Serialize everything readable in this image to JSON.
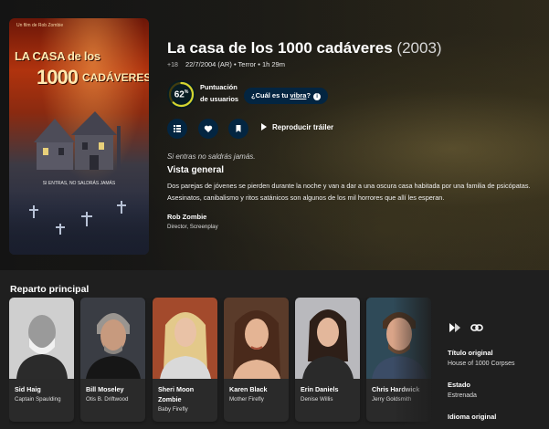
{
  "poster": {
    "credit": "Un film de Rob Zombie",
    "title_line1": "LA CASA de los",
    "title_line2": "1000",
    "title_line3": "CADÁVERES",
    "tagline": "SI ENTRAS, NO SALDRÁS JAMÁS"
  },
  "movie": {
    "title": "La casa de los 1000 cadáveres",
    "year": "(2003)",
    "certification": "+18",
    "release": "22/7/2004 (AR)",
    "genre": "Terror",
    "runtime": "1h 29m",
    "separator": "•"
  },
  "score": {
    "value": "62",
    "unit": "%",
    "fraction": 0.62,
    "label": "Puntuación de usuarios",
    "ring_color": "#d2d531"
  },
  "vibe": {
    "prefix": "¿Cuál es tu ",
    "link": "vibra",
    "suffix": "?",
    "info": "i"
  },
  "actions": {
    "trailer_label": "Reproducir tráiler",
    "list_icon": "list-icon",
    "favorite_icon": "heart-icon",
    "watchlist_icon": "bookmark-icon"
  },
  "tagline": "Si entras no saldrás jamás.",
  "overview": {
    "heading": "Vista general",
    "text": "Dos parejas de jóvenes se pierden durante la noche y van a dar a una oscura casa habitada por una familia de psicópatas. Asesinatos, canibalismo y ritos satánicos son algunos de los mil horrores que allí les esperan."
  },
  "crew": [
    {
      "name": "Rob Zombie",
      "job": "Director, Screenplay"
    }
  ],
  "cast_section": {
    "heading": "Reparto principal",
    "members": [
      {
        "name": "Sid Haig",
        "character": "Captain Spaulding"
      },
      {
        "name": "Bill Moseley",
        "character": "Otis B. Driftwood"
      },
      {
        "name": "Sheri Moon Zombie",
        "character": "Baby Firefly"
      },
      {
        "name": "Karen Black",
        "character": "Mother Firefly"
      },
      {
        "name": "Erin Daniels",
        "character": "Denise Willis"
      },
      {
        "name": "Chris Hardwick",
        "character": "Jerry Goldsmith"
      }
    ]
  },
  "facts": {
    "original_title_label": "Título original",
    "original_title": "House of 1000 Corpses",
    "status_label": "Estado",
    "status": "Estrenada",
    "language_label": "Idioma original"
  },
  "colors": {
    "accent_navy": "#032541",
    "background": "#1f1f1f"
  }
}
